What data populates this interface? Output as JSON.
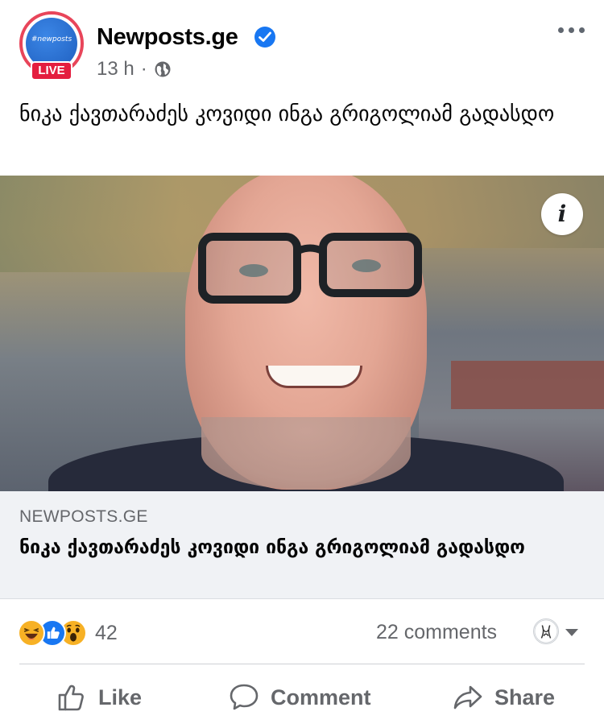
{
  "post": {
    "page_name": "Newposts.ge",
    "avatar_brand": "#newposts",
    "live_label": "LIVE",
    "time": "13 h",
    "separator": "·",
    "caption": "ნიკა ქავთარაძეს კოვიდი ინგა გრიგოლიამ გადასდო"
  },
  "link_preview": {
    "domain": "NEWPOSTS.GE",
    "title": "ნიკა ქავთარაძეს კოვიდი ინგა გრიგოლიამ გადასდო"
  },
  "reactions": {
    "icons": [
      "haha-icon",
      "like-icon",
      "wow-icon"
    ],
    "count": "42",
    "comments": "22 comments"
  },
  "actions": {
    "like": "Like",
    "comment": "Comment",
    "share": "Share"
  },
  "colors": {
    "accent": "#1877f2",
    "live": "#e41e3f",
    "muted_text": "#65676b",
    "link_bg": "#f0f2f5"
  }
}
